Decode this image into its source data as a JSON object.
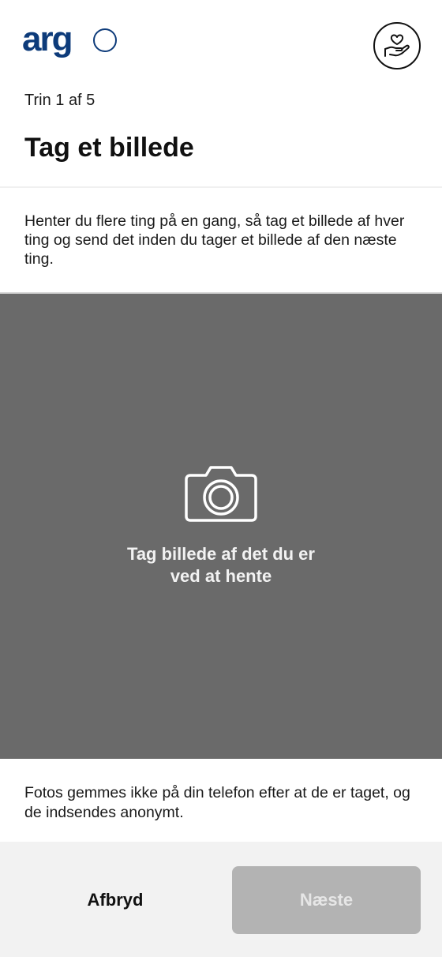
{
  "header": {
    "logo_text": "argo",
    "logo_icon": "argo-logo",
    "donate_icon": "heart-in-hand-icon"
  },
  "step": {
    "label": "Trin 1 af 5"
  },
  "title": "Tag et billede",
  "intro": "Henter du flere ting på en gang, så tag et billede af hver ting og send det inden du tager et billede af den næste ting.",
  "camera": {
    "icon": "camera-icon",
    "line1": "Tag billede af det du er",
    "line2": "ved at hente",
    "background_color": "#6a6a6a"
  },
  "privacy": "Fotos gemmes ikke på din telefon efter at de er taget, og de indsendes anonymt.",
  "footer": {
    "cancel_label": "Afbryd",
    "next_label": "Næste",
    "next_disabled": true
  },
  "colors": {
    "brand": "#0d3b7a",
    "button_disabled": "#b3b3b3",
    "footer_bg": "#f2f2f2"
  }
}
